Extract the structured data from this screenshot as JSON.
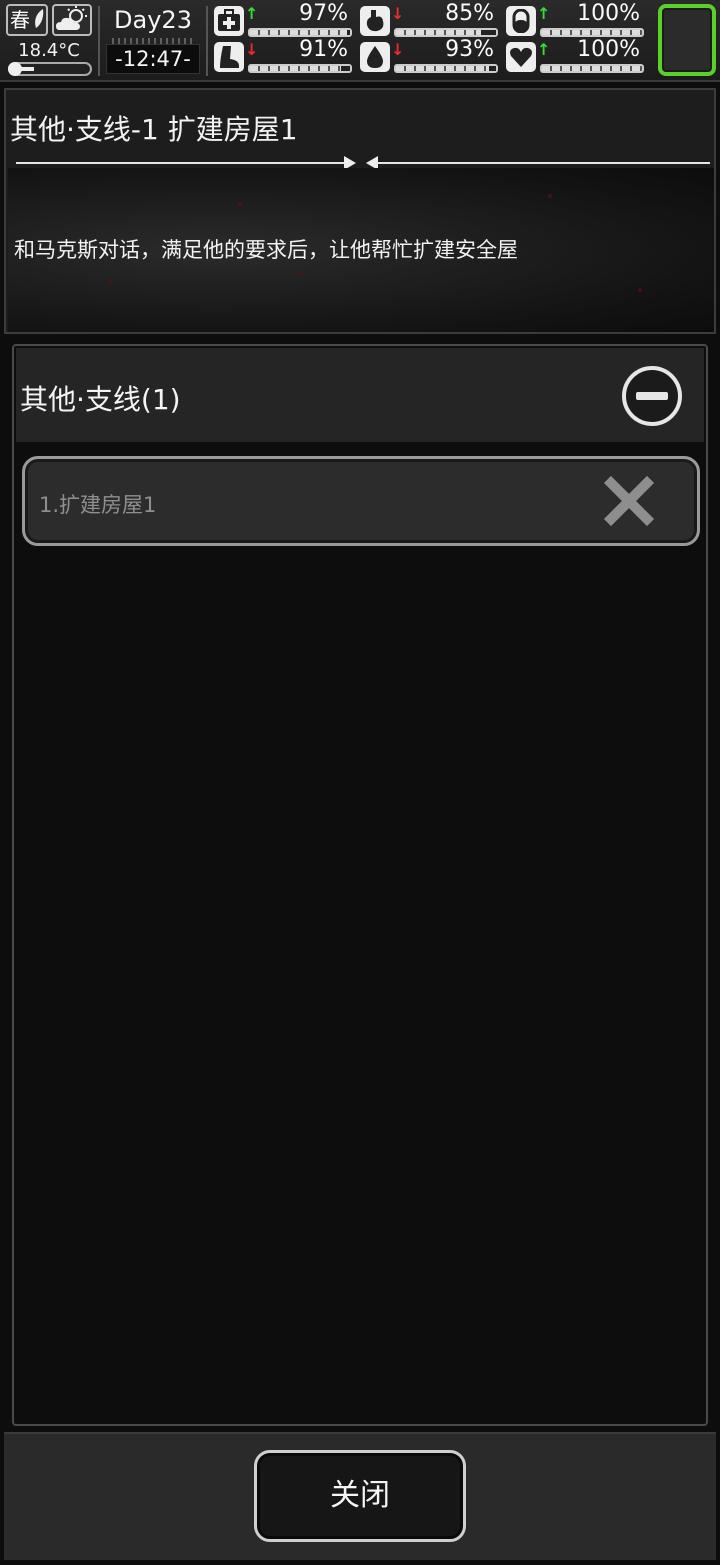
{
  "status": {
    "season": "春",
    "temperature": "18.4°C",
    "day": "Day23",
    "time": "-12:47-",
    "stats": [
      {
        "icon": "medkit-icon",
        "trend": "up",
        "value": "97%",
        "level": 0.97
      },
      {
        "icon": "stomach-icon",
        "trend": "down",
        "value": "85%",
        "level": 0.85
      },
      {
        "icon": "pill-icon",
        "trend": "up",
        "value": "100%",
        "level": 1.0
      },
      {
        "icon": "boot-icon",
        "trend": "down",
        "value": "91%",
        "level": 0.91
      },
      {
        "icon": "water-drop-icon",
        "trend": "down",
        "value": "93%",
        "level": 0.93
      },
      {
        "icon": "heart-icon",
        "trend": "up",
        "value": "100%",
        "level": 1.0
      }
    ],
    "slot_color": "#59d12a"
  },
  "quest_detail": {
    "title": "其他·支线-1 扩建房屋1",
    "description": "和马克斯对话，满足他的要求后，让他帮忙扩建安全屋"
  },
  "quest_list": {
    "header": "其他·支线(1)",
    "items": [
      {
        "label": "1.扩建房屋1",
        "status_icon": "close-x-icon"
      }
    ]
  },
  "footer": {
    "close_label": "关闭"
  }
}
